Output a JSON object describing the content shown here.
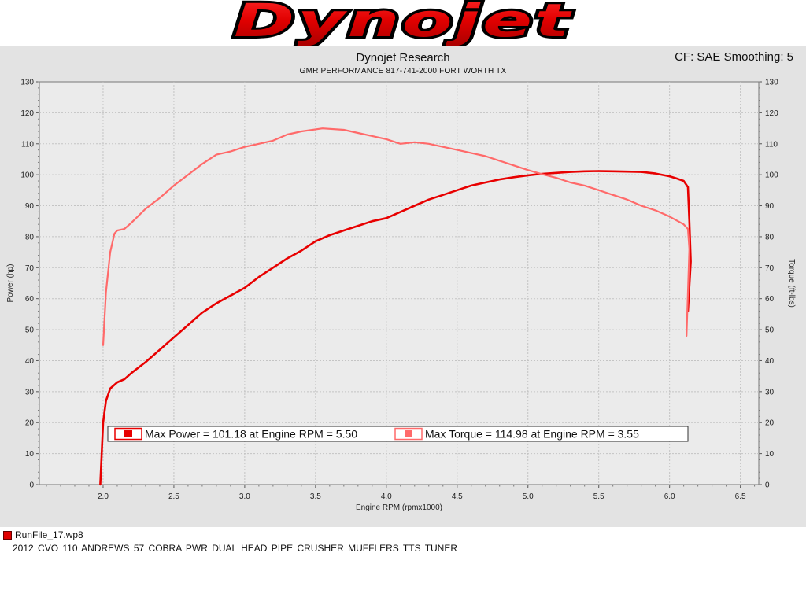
{
  "logo": {
    "text": "Dynojet"
  },
  "header": {
    "title": "Dynojet Research",
    "subtitle": "GMR PERFORMANCE 817-741-2000  FORT WORTH TX",
    "correction": "CF: SAE Smoothing: 5"
  },
  "colors": {
    "power": "#e80000",
    "torque": "#ff6a6a",
    "background": "#e3e3e3",
    "plot": "#ebebeb"
  },
  "chart_data": {
    "type": "line",
    "xlabel": "Engine RPM (rpmx1000)",
    "ylabel": "Power (hp)",
    "y2label": "Torque (ft-lbs)",
    "xlim": [
      1.55,
      6.63
    ],
    "ylim": [
      0,
      130
    ],
    "xticks": [
      "2.0",
      "2.5",
      "3.0",
      "3.5",
      "4.0",
      "4.5",
      "5.0",
      "5.5",
      "6.0",
      "6.5"
    ],
    "yticks": [
      "0",
      "10",
      "20",
      "30",
      "40",
      "50",
      "60",
      "70",
      "80",
      "90",
      "100",
      "110",
      "120",
      "130"
    ],
    "grid": true,
    "series": [
      {
        "name": "Power",
        "axis": "left",
        "x": [
          1.98,
          1.99,
          2.0,
          2.02,
          2.05,
          2.1,
          2.15,
          2.2,
          2.3,
          2.4,
          2.5,
          2.6,
          2.7,
          2.8,
          2.9,
          3.0,
          3.1,
          3.2,
          3.3,
          3.4,
          3.5,
          3.6,
          3.7,
          3.8,
          3.9,
          4.0,
          4.1,
          4.2,
          4.3,
          4.4,
          4.5,
          4.6,
          4.7,
          4.8,
          4.9,
          5.0,
          5.1,
          5.2,
          5.3,
          5.4,
          5.5,
          5.6,
          5.7,
          5.8,
          5.9,
          6.0,
          6.05,
          6.1,
          6.13,
          6.14,
          6.15,
          6.13
        ],
        "values": [
          0,
          10,
          20,
          27,
          31,
          33,
          34,
          36,
          39.5,
          43.5,
          47.5,
          51.5,
          55.5,
          58.5,
          61,
          63.5,
          67,
          70,
          73,
          75.5,
          78.5,
          80.5,
          82,
          83.5,
          85,
          86,
          88,
          90,
          92,
          93.5,
          95,
          96.5,
          97.5,
          98.5,
          99.2,
          99.8,
          100.3,
          100.6,
          100.9,
          101.1,
          101.18,
          101.1,
          101,
          100.9,
          100.4,
          99.5,
          98.8,
          98,
          96,
          85,
          72,
          56
        ]
      },
      {
        "name": "Torque",
        "axis": "right",
        "x": [
          2.0,
          2.02,
          2.05,
          2.08,
          2.1,
          2.15,
          2.2,
          2.3,
          2.4,
          2.5,
          2.6,
          2.7,
          2.8,
          2.9,
          3.0,
          3.1,
          3.2,
          3.3,
          3.4,
          3.55,
          3.7,
          3.8,
          3.9,
          4.0,
          4.1,
          4.2,
          4.3,
          4.4,
          4.5,
          4.6,
          4.7,
          4.8,
          4.9,
          5.0,
          5.1,
          5.2,
          5.3,
          5.4,
          5.5,
          5.6,
          5.7,
          5.8,
          5.9,
          6.0,
          6.1,
          6.13,
          6.14,
          6.13,
          6.12
        ],
        "values": [
          45,
          62,
          75,
          81,
          82,
          82.5,
          84.5,
          89,
          92.5,
          96.5,
          100,
          103.5,
          106.5,
          107.5,
          109,
          110,
          111,
          113,
          114,
          114.98,
          114.5,
          113.5,
          112.5,
          111.5,
          110,
          110.5,
          110,
          109,
          108,
          107,
          106,
          104.5,
          103,
          101.5,
          100.2,
          99,
          97.5,
          96.5,
          95,
          93.5,
          92,
          90,
          88.5,
          86.5,
          84,
          82.5,
          76,
          62,
          48
        ]
      }
    ],
    "legend": {
      "placement": "bottom-center",
      "entries": [
        "Max Power = 101.18 at Engine RPM = 5.50",
        "Max Torque = 114.98 at Engine RPM = 3.55"
      ]
    }
  },
  "run": {
    "file": "RunFile_17.wp8",
    "description": "2012 CVO 110 ANDREWS 57 COBRA PWR DUAL HEAD PIPE CRUSHER MUFFLERS TTS TUNER"
  }
}
